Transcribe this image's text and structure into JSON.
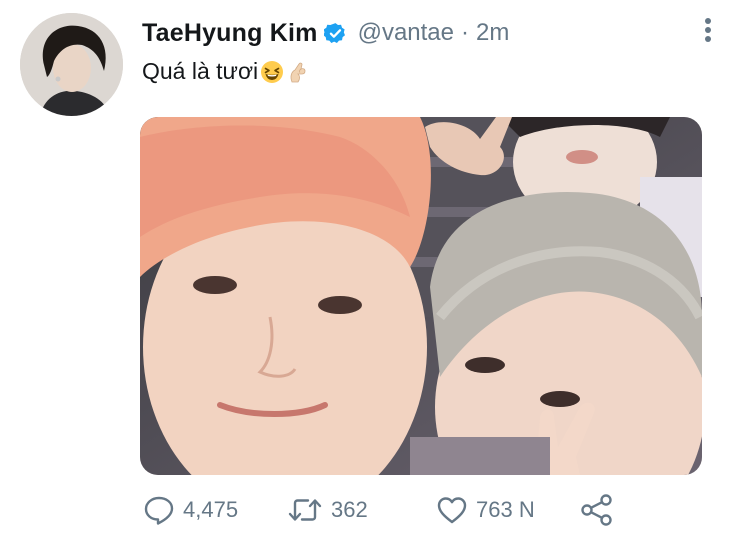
{
  "tweet": {
    "author_name": "TaeHyung Kim",
    "handle": "@vantae",
    "separator": "·",
    "time": "2m",
    "text": "Quá là tươi",
    "emoji": [
      "grinning-squinting-face-emoji",
      "pinching-hand-emoji"
    ]
  },
  "actions": {
    "reply_count": "4,475",
    "retweet_count": "362",
    "like_count": "763 N"
  },
  "colors": {
    "text": "#14171a",
    "secondary": "#657786",
    "verified": "#1da1f2"
  },
  "icons": [
    "avatar-photo",
    "verified-badge-icon",
    "more-options-icon",
    "reply-icon",
    "retweet-icon",
    "like-icon",
    "share-icon"
  ]
}
